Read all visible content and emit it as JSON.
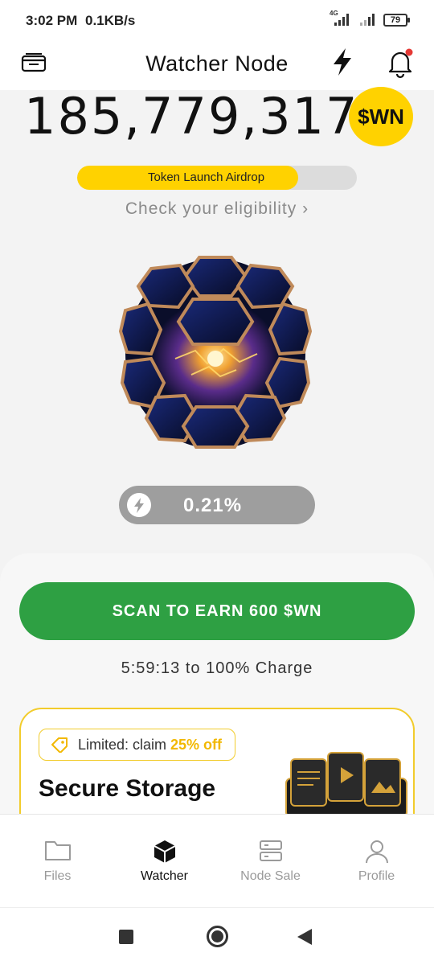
{
  "status_bar": {
    "time": "3:02 PM",
    "network_speed": "0.1KB/s",
    "network_type": "4G",
    "battery": "79"
  },
  "header": {
    "title": "Watcher Node",
    "left_icon": "wallet-icon",
    "icons": [
      "lightning-bolt-icon",
      "notification-bell-icon"
    ],
    "notification_dot_color": "#e53935"
  },
  "balance": {
    "amount": "185,779,317",
    "token_badge": "$WN",
    "token_badge_color": "#ffd200"
  },
  "airdrop": {
    "label": "Token Launch Airdrop",
    "progress": 0.79,
    "eligibility_link": "Check your eligibility"
  },
  "charge": {
    "value": "0.21%"
  },
  "actions": {
    "scan_button": "SCAN TO EARN 600 $WN",
    "scan_button_color": "#2ea043",
    "charge_time": "5:59:13 to 100% Charge"
  },
  "promo": {
    "badge_prefix": "Limited: claim ",
    "badge_highlight": "25% off",
    "title": "Secure Storage",
    "accent_color": "#f2cc2c"
  },
  "bottom_nav": {
    "items": [
      {
        "label": "Files",
        "icon": "folder-icon"
      },
      {
        "label": "Watcher",
        "icon": "cube-icon"
      },
      {
        "label": "Node Sale",
        "icon": "server-icon"
      },
      {
        "label": "Profile",
        "icon": "user-icon"
      }
    ],
    "active": "Watcher"
  },
  "system_nav": {
    "icons": [
      "recents-square-icon",
      "home-circle-icon",
      "back-triangle-icon"
    ]
  }
}
